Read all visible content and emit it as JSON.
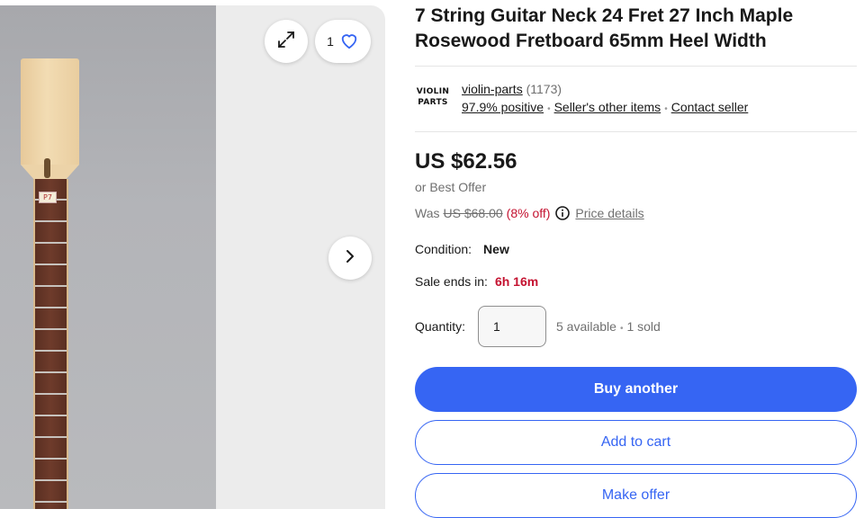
{
  "gallery": {
    "watch_count": "1",
    "sticker_text": "P7",
    "icons": [
      "expand-icon",
      "heart-icon",
      "chevron-right-icon"
    ]
  },
  "listing": {
    "title": "7 String Guitar Neck 24 Fret 27 Inch Maple Rosewood Fretboard 65mm Heel Width"
  },
  "seller": {
    "logo_line1": "VIOLIN",
    "logo_line2": "PARTS",
    "name": "violin-parts",
    "feedback_count": "(1173)",
    "positive": "97.9% positive",
    "other_items": "Seller's other items",
    "contact": "Contact seller"
  },
  "price": {
    "amount": "US $62.56",
    "best_offer": "or Best Offer",
    "was_label": "Was",
    "was_amount": "US $68.00",
    "discount": "(8% off)",
    "details": "Price details"
  },
  "condition": {
    "label": "Condition:",
    "value": "New"
  },
  "sale": {
    "label": "Sale ends in:",
    "value": "6h 16m"
  },
  "quantity": {
    "label": "Quantity:",
    "value": "1",
    "available": "5 available",
    "sold": "1 sold"
  },
  "buttons": {
    "buy": "Buy another",
    "cart": "Add to cart",
    "offer": "Make offer"
  },
  "colors": {
    "primary": "#3665f3",
    "sale_red": "#c41230",
    "muted_text": "#707070"
  }
}
